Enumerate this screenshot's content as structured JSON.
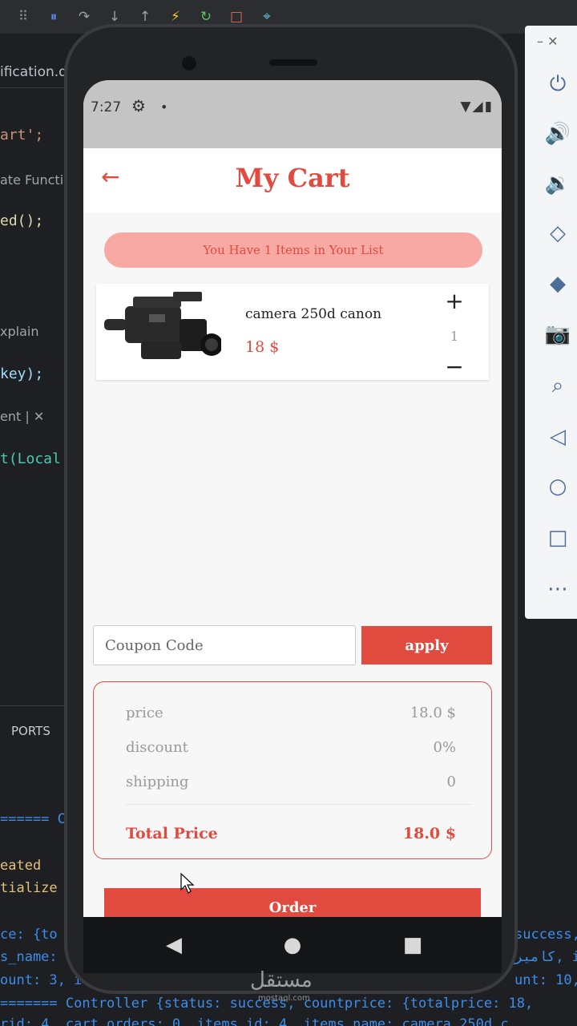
{
  "ide": {
    "toolbar_icons": [
      "drag-handle-icon",
      "pause-icon",
      "step-over-icon",
      "step-into-icon",
      "step-out-icon",
      "hot-reload-icon",
      "hot-restart-icon",
      "stop-icon",
      "inspect-icon"
    ],
    "tab_label": "ification.d",
    "code_lines": [
      "art';",
      "ate Functic",
      "ed();",
      "xplain",
      "key);",
      "ent | ✕",
      "t(Local"
    ],
    "panel_tab": "PORTS",
    "terminal_lines": [
      "====== C",
      "eated",
      "tialize",
      "ce: {to",
      "s_name:",
      "ount: 3, i",
      "======= Controller {status: success, countprice: {totalprice: 18,",
      "rid: 4, cart_orders: 0, items_id: 4, items_name: camera 250d c"
    ],
    "terminal_right": [
      "success,",
      "كامير, i",
      "unt: 10, i"
    ]
  },
  "emulator": {
    "window_controls": "–  ✕",
    "tools": [
      "power-icon",
      "volume-up-icon",
      "volume-down-icon",
      "rotate-left-icon",
      "rotate-right-icon",
      "screenshot-icon",
      "zoom-icon",
      "back-icon",
      "home-icon",
      "overview-icon",
      "more-icon"
    ]
  },
  "status_bar": {
    "time": "7:27",
    "right_icons": "▼◢▮"
  },
  "app": {
    "title": "My Cart",
    "banner": "You Have 1 Items in Your List",
    "item": {
      "name": "camera 250d canon",
      "price": "18 $",
      "quantity": "1"
    },
    "coupon": {
      "placeholder": "Coupon Code",
      "apply_label": "apply"
    },
    "summary": {
      "price_label": "price",
      "price_value": "18.0 $",
      "discount_label": "discount",
      "discount_value": "0%",
      "shipping_label": "shipping",
      "shipping_value": "0",
      "total_label": "Total Price",
      "total_value": "18.0 $"
    },
    "order_label": "Order"
  },
  "watermark": {
    "text": "مستقل",
    "sub": "mostaql.com"
  },
  "colors": {
    "accent": "#e04a3f",
    "banner_bg": "#f9a9a3"
  }
}
